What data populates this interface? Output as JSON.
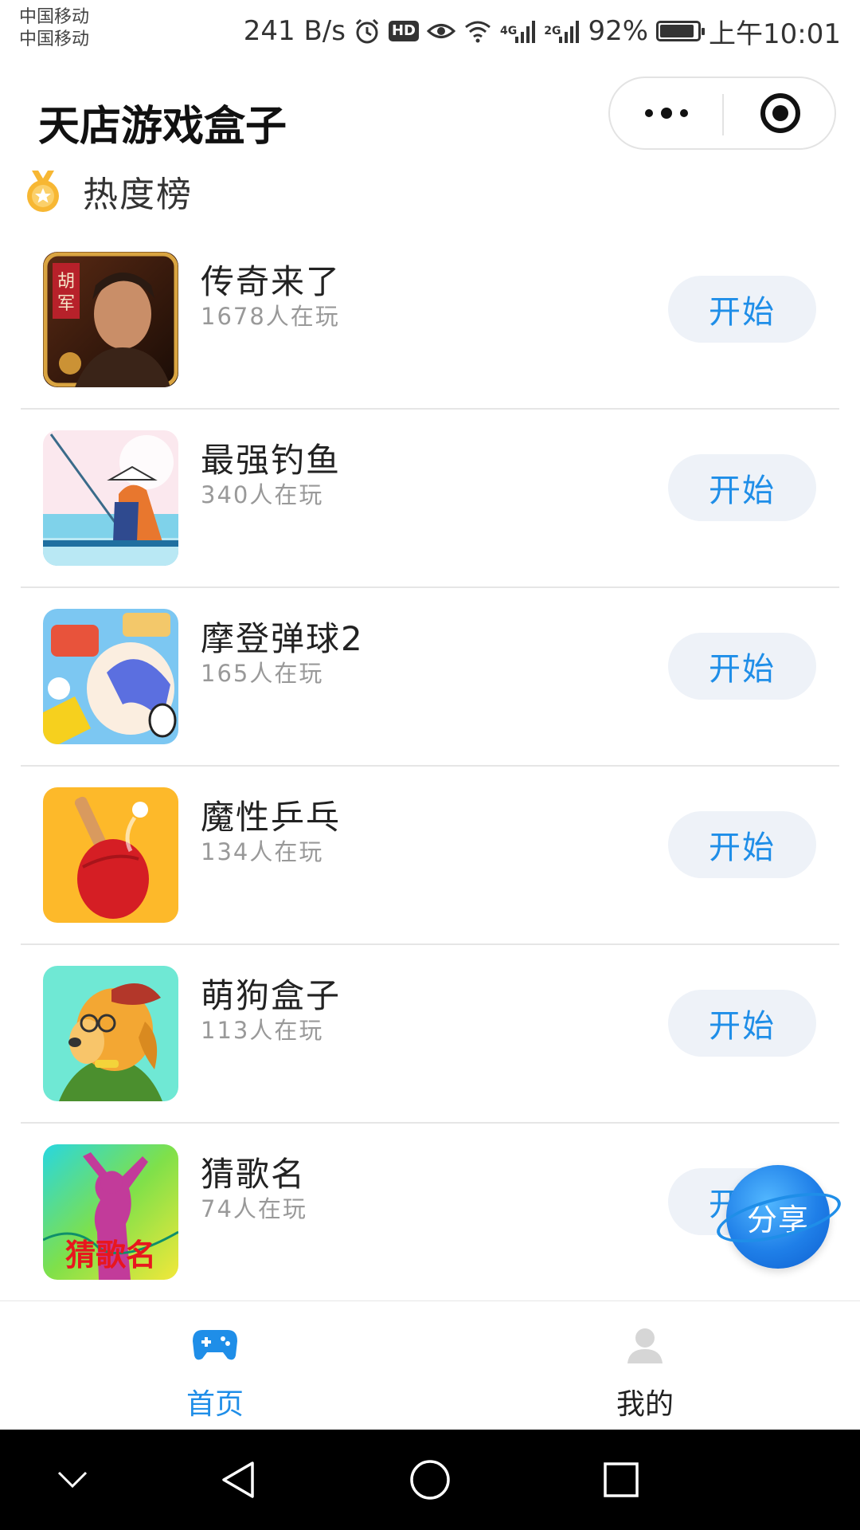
{
  "status_bar": {
    "carrier_1": "中国移动",
    "carrier_2": "中国移动",
    "net_speed": "241 B/s",
    "hd": "HD",
    "network_1": "4G",
    "network_2": "2G",
    "battery": "92%",
    "battery_level": 0.92,
    "time": "上午10:01"
  },
  "nav": {
    "title": "天店游戏盒子",
    "icons": [
      "more-icon",
      "close-target-icon"
    ]
  },
  "section": {
    "title": "热度榜",
    "icon": "medal-icon"
  },
  "games": [
    {
      "name": "传奇来了",
      "players": "1678人在玩",
      "button": "开始",
      "icon_text": "胡军"
    },
    {
      "name": "最强钓鱼",
      "players": "340人在玩",
      "button": "开始"
    },
    {
      "name": "摩登弹球2",
      "players": "165人在玩",
      "button": "开始"
    },
    {
      "name": "魔性乒乓",
      "players": "134人在玩",
      "button": "开始"
    },
    {
      "name": "萌狗盒子",
      "players": "113人在玩",
      "button": "开始"
    },
    {
      "name": "猜歌名",
      "players": "74人在玩",
      "button": "开始",
      "icon_text": "猜歌名"
    }
  ],
  "share": {
    "label": "分享"
  },
  "tabbar": {
    "home": {
      "label": "首页",
      "icon": "gamepad-icon"
    },
    "mine": {
      "label": "我的",
      "icon": "user-icon"
    }
  },
  "colors": {
    "accent": "#1f8ee8",
    "button_bg": "#eef2f8",
    "secondary_text": "#999999",
    "divider": "#e6e6e6"
  }
}
